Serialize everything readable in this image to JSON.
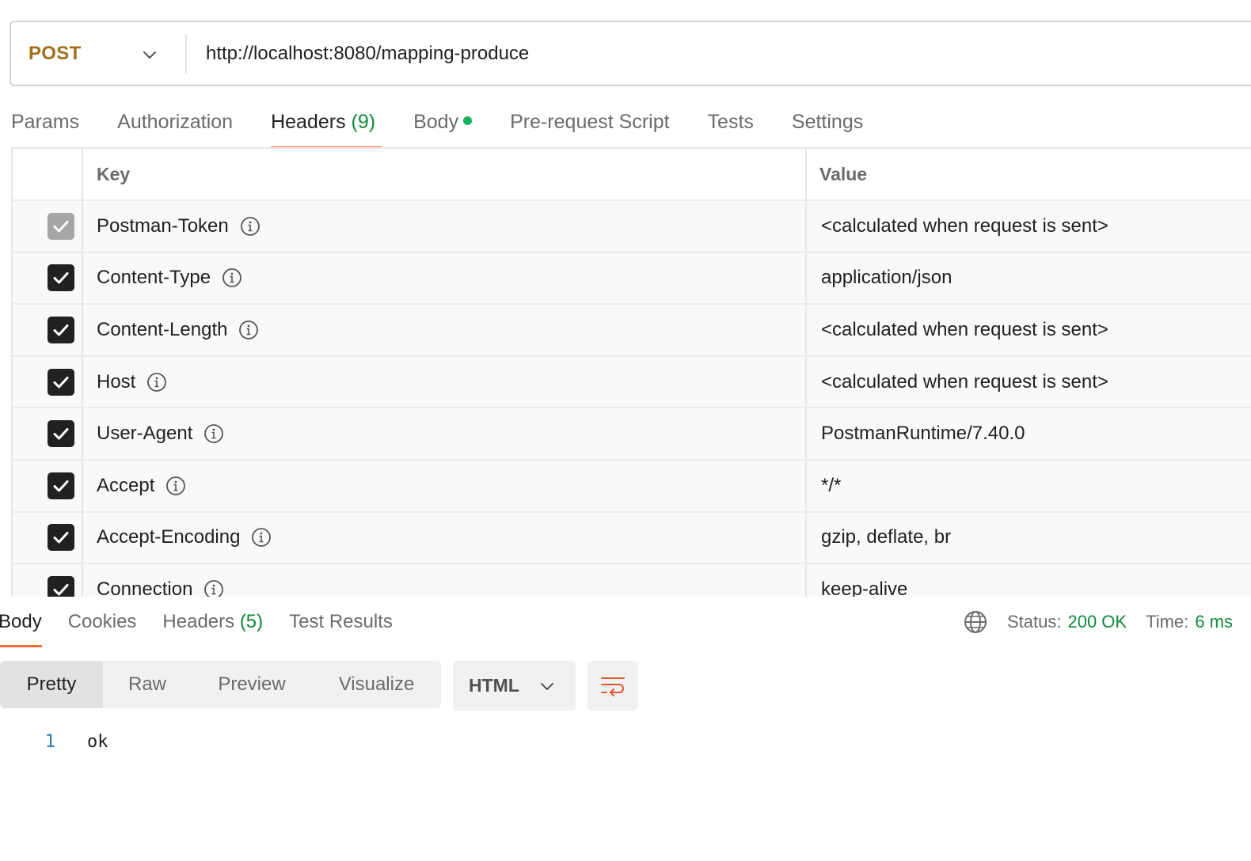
{
  "request": {
    "method": "POST",
    "url": "http://localhost:8080/mapping-produce"
  },
  "request_tabs": [
    {
      "label": "Params",
      "count": "",
      "active": false
    },
    {
      "label": "Authorization",
      "count": "",
      "active": false
    },
    {
      "label": "Headers",
      "count": "(9)",
      "active": true
    },
    {
      "label": "Body",
      "count": "",
      "active": false,
      "dot": true
    },
    {
      "label": "Pre-request Script",
      "count": "",
      "active": false
    },
    {
      "label": "Tests",
      "count": "",
      "active": false
    },
    {
      "label": "Settings",
      "count": "",
      "active": false
    }
  ],
  "headers_table": {
    "columns": {
      "key": "Key",
      "value": "Value"
    },
    "rows": [
      {
        "key": "Postman-Token",
        "value": "<calculated when request is sent>",
        "checked": true,
        "disabled": true
      },
      {
        "key": "Content-Type",
        "value": "application/json",
        "checked": true,
        "disabled": false
      },
      {
        "key": "Content-Length",
        "value": "<calculated when request is sent>",
        "checked": true,
        "disabled": false
      },
      {
        "key": "Host",
        "value": "<calculated when request is sent>",
        "checked": true,
        "disabled": false
      },
      {
        "key": "User-Agent",
        "value": "PostmanRuntime/7.40.0",
        "checked": true,
        "disabled": false
      },
      {
        "key": "Accept",
        "value": "*/*",
        "checked": true,
        "disabled": false
      },
      {
        "key": "Accept-Encoding",
        "value": "gzip, deflate, br",
        "checked": true,
        "disabled": false
      },
      {
        "key": "Connection",
        "value": "keep-alive",
        "checked": true,
        "disabled": false
      }
    ]
  },
  "response": {
    "tabs": [
      {
        "label": "Body",
        "count": "",
        "active": true
      },
      {
        "label": "Cookies",
        "count": "",
        "active": false
      },
      {
        "label": "Headers",
        "count": "(5)",
        "active": false
      },
      {
        "label": "Test Results",
        "count": "",
        "active": false
      }
    ],
    "status_label": "Status:",
    "status_value": "200 OK",
    "time_label": "Time:",
    "time_value": "6 ms",
    "view_modes": [
      {
        "label": "Pretty",
        "active": true
      },
      {
        "label": "Raw",
        "active": false
      },
      {
        "label": "Preview",
        "active": false
      },
      {
        "label": "Visualize",
        "active": false
      }
    ],
    "format": "HTML",
    "body_lines": [
      {
        "number": "1",
        "text": "ok"
      }
    ]
  },
  "colors": {
    "method": "#a2701a",
    "accent": "#ff6c37",
    "success": "#0f8a3b",
    "body_dot": "#17b35b"
  }
}
